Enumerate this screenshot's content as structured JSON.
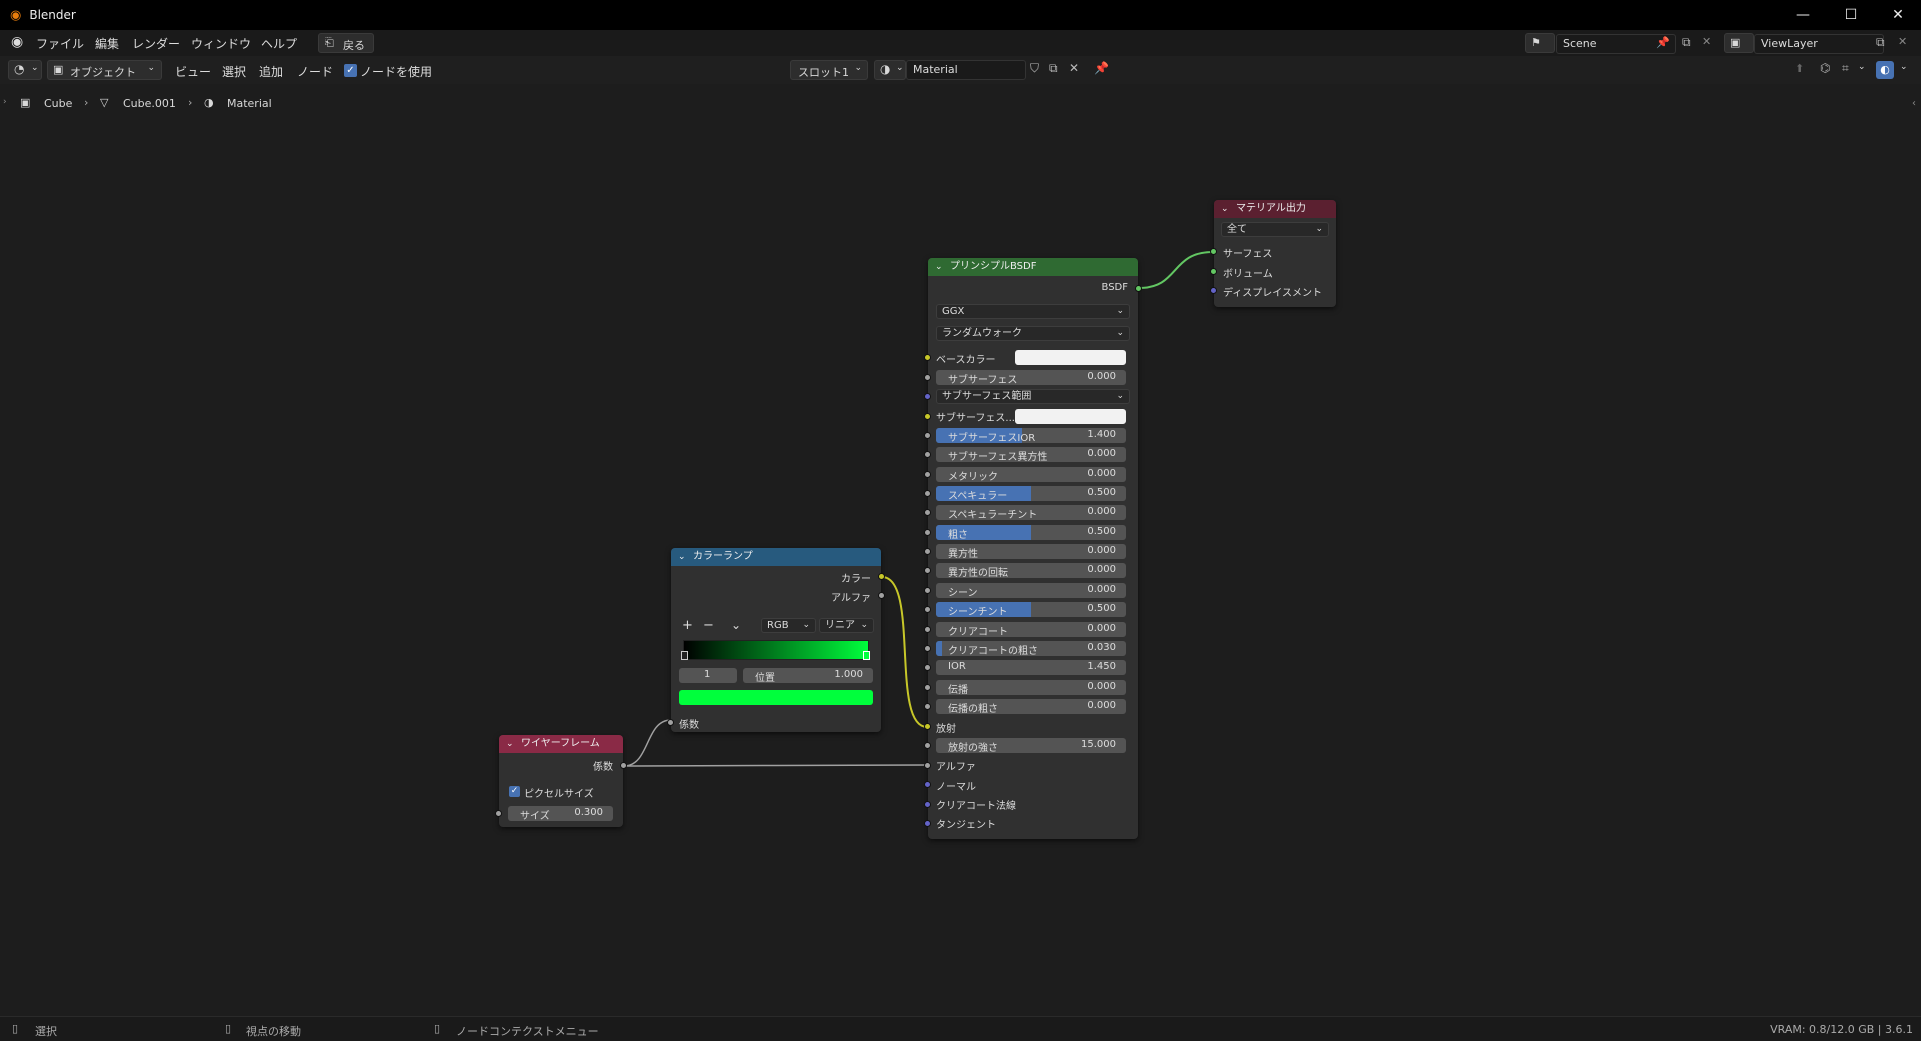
{
  "window": {
    "title": "Blender"
  },
  "menu": {
    "items": [
      "ファイル",
      "編集",
      "レンダー",
      "ウィンドウ",
      "ヘルプ"
    ],
    "back_label": "戻る"
  },
  "scene": {
    "name": "Scene",
    "view_layer": "ViewLayer"
  },
  "header": {
    "mode": "オブジェクト",
    "items": [
      "ビュー",
      "選択",
      "追加",
      "ノード"
    ],
    "use_nodes_label": "ノードを使用",
    "use_nodes_checked": true,
    "slot": "スロット1",
    "material_name": "Material"
  },
  "breadcrumb": {
    "items": [
      "Cube",
      "Cube.001",
      "Material"
    ]
  },
  "nodes": {
    "output": {
      "title": "マテリアル出力",
      "target": "全て",
      "inputs": [
        "サーフェス",
        "ボリューム",
        "ディスプレイスメント"
      ]
    },
    "bsdf": {
      "title": "プリンシプルBSDF",
      "output": "BSDF",
      "distribution": "GGX",
      "subsurface_method": "ランダムウォーク",
      "base_color_label": "ベースカラー",
      "subsurface": {
        "label": "サブサーフェス",
        "value": "0.000"
      },
      "subsurface_radius": "サブサーフェス範囲",
      "subsurface_color_label": "サブサーフェス...",
      "params": [
        {
          "label": "サブサーフェスIOR",
          "value": "1.400",
          "fill": 0.45
        },
        {
          "label": "サブサーフェス異方性",
          "value": "0.000",
          "fill": 0
        },
        {
          "label": "メタリック",
          "value": "0.000",
          "fill": 0
        },
        {
          "label": "スペキュラー",
          "value": "0.500",
          "fill": 0.5
        },
        {
          "label": "スペキュラーチント",
          "value": "0.000",
          "fill": 0
        },
        {
          "label": "粗さ",
          "value": "0.500",
          "fill": 0.5
        },
        {
          "label": "異方性",
          "value": "0.000",
          "fill": 0
        },
        {
          "label": "異方性の回転",
          "value": "0.000",
          "fill": 0
        },
        {
          "label": "シーン",
          "value": "0.000",
          "fill": 0
        },
        {
          "label": "シーンチント",
          "value": "0.500",
          "fill": 0.5
        },
        {
          "label": "クリアコート",
          "value": "0.000",
          "fill": 0
        },
        {
          "label": "クリアコートの粗さ",
          "value": "0.030",
          "fill": 0.03
        },
        {
          "label": "IOR",
          "value": "1.450",
          "fill": 0
        },
        {
          "label": "伝播",
          "value": "0.000",
          "fill": 0
        },
        {
          "label": "伝播の粗さ",
          "value": "0.000",
          "fill": 0
        }
      ],
      "emission_label": "放射",
      "emission_strength": {
        "label": "放射の強さ",
        "value": "15.000"
      },
      "tail_inputs": [
        "アルファ",
        "ノーマル",
        "クリアコート法線",
        "タンジェント"
      ]
    },
    "colorramp": {
      "title": "カラーランプ",
      "outputs": [
        "カラー",
        "アルファ"
      ],
      "color_mode": "RGB",
      "interpolation": "リニア",
      "stop_index": "1",
      "position_label": "位置",
      "position_value": "1.000",
      "input": "係数",
      "plus": "+",
      "minus": "−",
      "chevron": "⌄"
    },
    "wireframe": {
      "title": "ワイヤーフレーム",
      "output": "係数",
      "pixel_size_label": "ピクセルサイズ",
      "pixel_size_checked": true,
      "size_label": "サイズ",
      "size_value": "0.300"
    }
  },
  "statusbar": {
    "left": "選択",
    "middle": "視点の移動",
    "right": "ノードコンテクストメニュー",
    "info": "VRAM: 0.8/12.0 GB | 3.6.1"
  },
  "colors": {
    "output_header": "#5b2030",
    "bsdf_header": "#2f6a32",
    "colorramp_header": "#275a7e",
    "wireframe_header": "#8a2a46",
    "accent_blue": "#4772b3",
    "ramp_green": "#00ff3c"
  }
}
